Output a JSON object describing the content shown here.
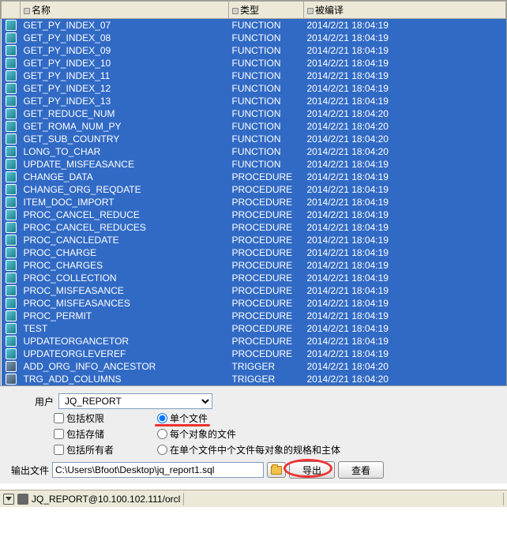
{
  "columns": {
    "name": "名称",
    "type": "类型",
    "compiled": "被编译"
  },
  "rows": [
    {
      "name": "GET_PY_INDEX_07",
      "type": "FUNCTION",
      "date": "2014/2/21 18:04:19",
      "icon": "func"
    },
    {
      "name": "GET_PY_INDEX_08",
      "type": "FUNCTION",
      "date": "2014/2/21 18:04:19",
      "icon": "func"
    },
    {
      "name": "GET_PY_INDEX_09",
      "type": "FUNCTION",
      "date": "2014/2/21 18:04:19",
      "icon": "func"
    },
    {
      "name": "GET_PY_INDEX_10",
      "type": "FUNCTION",
      "date": "2014/2/21 18:04:19",
      "icon": "func"
    },
    {
      "name": "GET_PY_INDEX_11",
      "type": "FUNCTION",
      "date": "2014/2/21 18:04:19",
      "icon": "func"
    },
    {
      "name": "GET_PY_INDEX_12",
      "type": "FUNCTION",
      "date": "2014/2/21 18:04:19",
      "icon": "func"
    },
    {
      "name": "GET_PY_INDEX_13",
      "type": "FUNCTION",
      "date": "2014/2/21 18:04:19",
      "icon": "func"
    },
    {
      "name": "GET_REDUCE_NUM",
      "type": "FUNCTION",
      "date": "2014/2/21 18:04:20",
      "icon": "func"
    },
    {
      "name": "GET_ROMA_NUM_PY",
      "type": "FUNCTION",
      "date": "2014/2/21 18:04:20",
      "icon": "func"
    },
    {
      "name": "GET_SUB_COUNTRY",
      "type": "FUNCTION",
      "date": "2014/2/21 18:04:20",
      "icon": "func"
    },
    {
      "name": "LONG_TO_CHAR",
      "type": "FUNCTION",
      "date": "2014/2/21 18:04:20",
      "icon": "func"
    },
    {
      "name": "UPDATE_MISFEASANCE",
      "type": "FUNCTION",
      "date": "2014/2/21 18:04:19",
      "icon": "func"
    },
    {
      "name": "CHANGE_DATA",
      "type": "PROCEDURE",
      "date": "2014/2/21 18:04:19",
      "icon": "proc"
    },
    {
      "name": "CHANGE_ORG_REQDATE",
      "type": "PROCEDURE",
      "date": "2014/2/21 18:04:19",
      "icon": "proc"
    },
    {
      "name": "ITEM_DOC_IMPORT",
      "type": "PROCEDURE",
      "date": "2014/2/21 18:04:19",
      "icon": "proc"
    },
    {
      "name": "PROC_CANCEL_REDUCE",
      "type": "PROCEDURE",
      "date": "2014/2/21 18:04:19",
      "icon": "proc"
    },
    {
      "name": "PROC_CANCEL_REDUCES",
      "type": "PROCEDURE",
      "date": "2014/2/21 18:04:19",
      "icon": "proc"
    },
    {
      "name": "PROC_CANCLEDATE",
      "type": "PROCEDURE",
      "date": "2014/2/21 18:04:19",
      "icon": "proc"
    },
    {
      "name": "PROC_CHARGE",
      "type": "PROCEDURE",
      "date": "2014/2/21 18:04:19",
      "icon": "proc"
    },
    {
      "name": "PROC_CHARGES",
      "type": "PROCEDURE",
      "date": "2014/2/21 18:04:19",
      "icon": "proc"
    },
    {
      "name": "PROC_COLLECTION",
      "type": "PROCEDURE",
      "date": "2014/2/21 18:04:19",
      "icon": "proc"
    },
    {
      "name": "PROC_MISFEASANCE",
      "type": "PROCEDURE",
      "date": "2014/2/21 18:04:19",
      "icon": "proc"
    },
    {
      "name": "PROC_MISFEASANCES",
      "type": "PROCEDURE",
      "date": "2014/2/21 18:04:19",
      "icon": "proc"
    },
    {
      "name": "PROC_PERMIT",
      "type": "PROCEDURE",
      "date": "2014/2/21 18:04:19",
      "icon": "proc"
    },
    {
      "name": "TEST",
      "type": "PROCEDURE",
      "date": "2014/2/21 18:04:19",
      "icon": "proc"
    },
    {
      "name": "UPDATEORGANCETOR",
      "type": "PROCEDURE",
      "date": "2014/2/21 18:04:19",
      "icon": "proc"
    },
    {
      "name": "UPDATEORGLEVEREF",
      "type": "PROCEDURE",
      "date": "2014/2/21 18:04:19",
      "icon": "proc"
    },
    {
      "name": "ADD_ORG_INFO_ANCESTOR",
      "type": "TRIGGER",
      "date": "2014/2/21 18:04:20",
      "icon": "trig"
    },
    {
      "name": "TRG_ADD_COLUMNS",
      "type": "TRIGGER",
      "date": "2014/2/21 18:04:20",
      "icon": "trig"
    }
  ],
  "panel": {
    "user_label": "用户",
    "user_value": "JQ_REPORT",
    "chk_priv": "包括权限",
    "chk_storage": "包括存储",
    "chk_owner": "包括所有者",
    "rdo_single": "单个文件",
    "rdo_each": "每个对象的文件",
    "rdo_spec": "在单个文件中个文件每对象的规格和主体",
    "output_label": "输出文件",
    "output_value": "C:\\Users\\Bfoot\\Desktop\\jq_report1.sql",
    "export_btn": "导出",
    "view_btn": "查看"
  },
  "status": {
    "connection": "JQ_REPORT@10.100.102.111/orcl"
  }
}
